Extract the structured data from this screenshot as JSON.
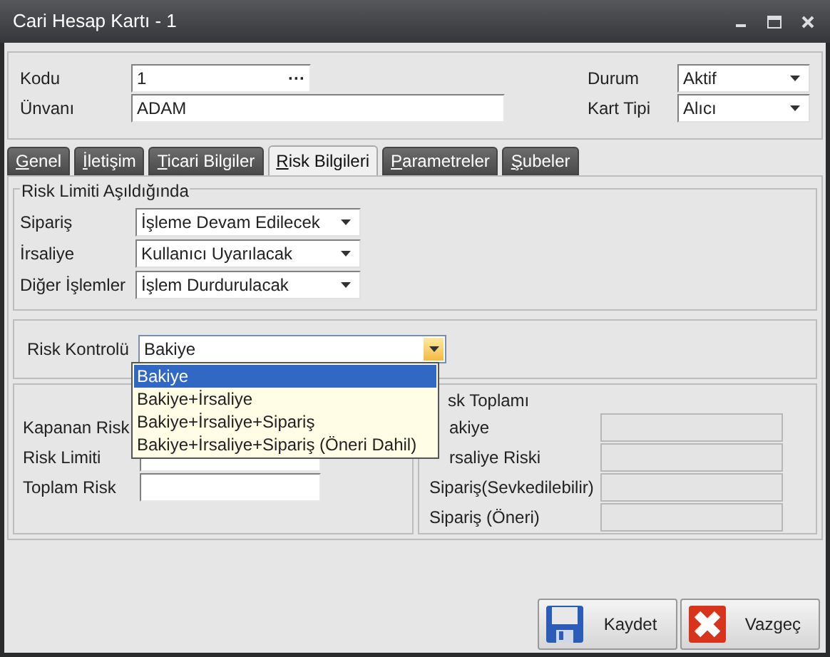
{
  "window": {
    "title": "Cari Hesap Kartı - 1"
  },
  "header": {
    "kodu": {
      "label": "Kodu",
      "value": "1",
      "button": "···"
    },
    "unvani": {
      "label": "Ünvanı",
      "value": "ADAM"
    },
    "durum": {
      "label": "Durum",
      "value": "Aktif"
    },
    "kart_tipi": {
      "label": "Kart Tipi",
      "value": "Alıcı"
    }
  },
  "tabs": [
    {
      "label": "Genel",
      "selected": false
    },
    {
      "label": "İletişim",
      "selected": false
    },
    {
      "label": "Ticari Bilgiler",
      "selected": false
    },
    {
      "label": "Risk Bilgileri",
      "selected": true
    },
    {
      "label": "Parametreler",
      "selected": false
    },
    {
      "label": "Şubeler",
      "selected": false
    }
  ],
  "risk_limit_group": {
    "title": "Risk Limiti Aşıldığında",
    "rows": [
      {
        "label": "Sipariş",
        "value": "İşleme Devam Edilecek"
      },
      {
        "label": "İrsaliye",
        "value": "Kullanıcı Uyarılacak"
      },
      {
        "label": "Diğer İşlemler",
        "value": "İşlem Durdurulacak"
      }
    ]
  },
  "risk_control": {
    "label": "Risk Kontrolü",
    "value": "Bakiye",
    "expanded": true,
    "options": [
      {
        "label": "Bakiye",
        "selected": true
      },
      {
        "label": "Bakiye+İrsaliye",
        "selected": false
      },
      {
        "label": "Bakiye+İrsaliye+Sipariş",
        "selected": false
      },
      {
        "label": "Bakiye+İrsaliye+Sipariş (Öneri Dahil)",
        "selected": false
      }
    ]
  },
  "left_fields": [
    {
      "label": "Kapanan Risk",
      "kind": "label"
    },
    {
      "label": "Risk Limiti",
      "kind": "field"
    },
    {
      "label": "Toplam Risk",
      "kind": "field"
    }
  ],
  "risk_total": {
    "title": "sk Toplamı",
    "rows": [
      {
        "label": "akiye",
        "disabled": true
      },
      {
        "label": "rsaliye Riski",
        "disabled": true
      },
      {
        "label": "Sipariş(Sevkedilebilir)",
        "disabled": true
      },
      {
        "label": "Sipariş (Öneri)",
        "disabled": true
      }
    ]
  },
  "buttons": [
    {
      "label": "Kaydet",
      "kind": "save"
    },
    {
      "label": "Vazgeç",
      "kind": "cancel"
    }
  ]
}
